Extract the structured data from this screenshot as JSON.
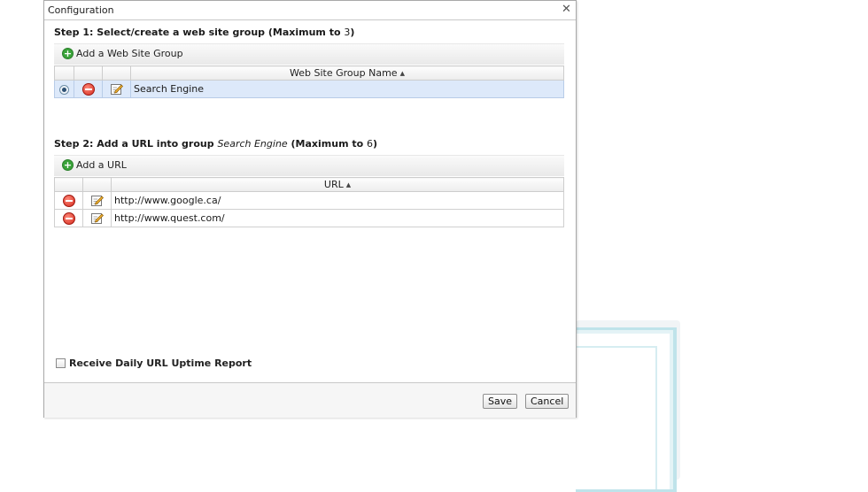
{
  "dialog": {
    "title": "Configuration",
    "close_glyph": "✕"
  },
  "step1": {
    "prefix": "Step 1: Select/create a web site group (Maximum to ",
    "max": "3",
    "suffix": ")",
    "add_label": "Add a Web Site Group",
    "column_header": "Web Site Group Name",
    "rows": [
      {
        "name": "Search Engine",
        "selected": true
      }
    ]
  },
  "step2": {
    "prefix": "Step 2: Add a URL into group ",
    "group": "Search Engine",
    "middle": " (Maximum to ",
    "max": "6",
    "suffix": ")",
    "add_label": "Add a URL",
    "column_header": "URL",
    "rows": [
      {
        "url": "http://www.google.ca/"
      },
      {
        "url": "http://www.quest.com/"
      }
    ]
  },
  "report_checkbox": {
    "label": "Receive Daily URL Uptime Report",
    "checked": false
  },
  "footer": {
    "save_label": "Save",
    "cancel_label": "Cancel"
  },
  "icons": {
    "add": "add-circle-icon",
    "delete": "delete-icon",
    "edit": "edit-icon",
    "sort": "sort-ascending-icon",
    "sort_glyph": "▲",
    "add_glyph": "+"
  },
  "colors": {
    "selected_row": "#dde9fa",
    "add_green": "#3aa33a",
    "delete_red": "#d42a1e"
  }
}
